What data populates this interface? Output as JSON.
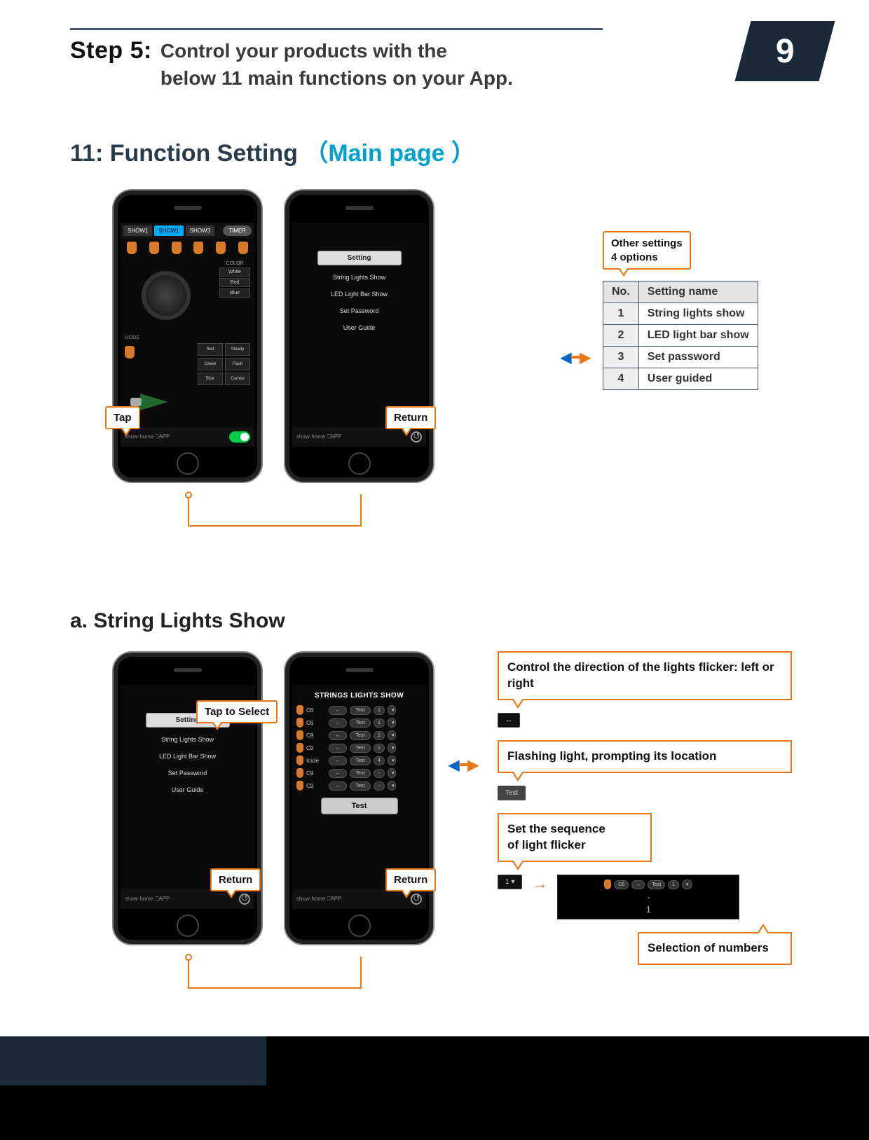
{
  "header": {
    "step_label": "Step 5:",
    "step_desc_line1": "Control your products with the",
    "step_desc_line2": "below 11 main functions on your App.",
    "page_number": "9"
  },
  "section11": {
    "title_prefix": "11:  Function Setting  ",
    "title_accent": "（Main page ）",
    "phone1": {
      "tabs": [
        "SHOW1",
        "SHOW1",
        "SHOW3"
      ],
      "timer": "TIMER",
      "color_label": "COLOR",
      "colors": [
        "White",
        "Red",
        "Blue"
      ],
      "mode_label": "MODE",
      "modes_left": [
        "Red",
        "Green",
        "Blue"
      ],
      "modes_right": [
        "Steady",
        "Flash",
        "Combo"
      ],
      "footer": "show·home  ⎕APP",
      "callout": "Tap"
    },
    "phone2": {
      "header": "Setting",
      "items": [
        "String Lights Show",
        "LED Light Bar Show",
        "Set Password",
        "User Guide"
      ],
      "footer": "show·home  ⎕APP",
      "callout": "Return"
    },
    "table": {
      "caption_line1": "Other settings",
      "caption_line2": "4 options",
      "headers": [
        "No.",
        "Setting name"
      ],
      "rows": [
        [
          "1",
          "String lights show"
        ],
        [
          "2",
          "LED light bar show"
        ],
        [
          "3",
          "Set password"
        ],
        [
          "4",
          "User guided"
        ]
      ]
    }
  },
  "sectionA": {
    "title": "a. String Lights Show",
    "phone3": {
      "header": "Setting",
      "items": [
        "String Lights Show",
        "LED Light Bar Show",
        "Set Password",
        "User Guide"
      ],
      "footer": "show·home  ⎕APP",
      "callout_select": "Tap to Select",
      "callout_return": "Return"
    },
    "phone4": {
      "title": "STRINGS LIGHTS SHOW",
      "rows": [
        {
          "name": "C6",
          "arrow": "↔",
          "test": "Test",
          "num": "1",
          "dd": "▾"
        },
        {
          "name": "C6",
          "arrow": "↔",
          "test": "Test",
          "num": "1",
          "dd": "▾"
        },
        {
          "name": "C9",
          "arrow": "↔",
          "test": "Test",
          "num": "1",
          "dd": "▾"
        },
        {
          "name": "C9",
          "arrow": "↔",
          "test": "Test",
          "num": "1",
          "dd": "▾"
        },
        {
          "name": "Icicle",
          "arrow": "↔",
          "test": "Test",
          "num": "4",
          "dd": "▾"
        },
        {
          "name": "C9",
          "arrow": "↔",
          "test": "Test",
          "num": "-",
          "dd": "▾"
        },
        {
          "name": "C9",
          "arrow": "↔",
          "test": "Test",
          "num": "-",
          "dd": "▾"
        }
      ],
      "test_button": "Test",
      "footer": "show·home  ⎕APP",
      "callout_return": "Return"
    },
    "annotations": {
      "direction": "Control the direction of the lights flicker: left or right",
      "direction_chip": "↔",
      "flashing": "Flashing light, prompting its location",
      "flashing_chip": "Test",
      "sequence_l1": "Set the sequence",
      "sequence_l2": "of light flicker",
      "seq_chip": "1   ▾",
      "demo_row": {
        "bulb": "",
        "name": "C6",
        "arrow": "↔",
        "test": "Test",
        "num": "1",
        "dd": "▾"
      },
      "demo_mid": "-",
      "demo_bot": "1",
      "selection_label": "Selection of numbers"
    }
  }
}
